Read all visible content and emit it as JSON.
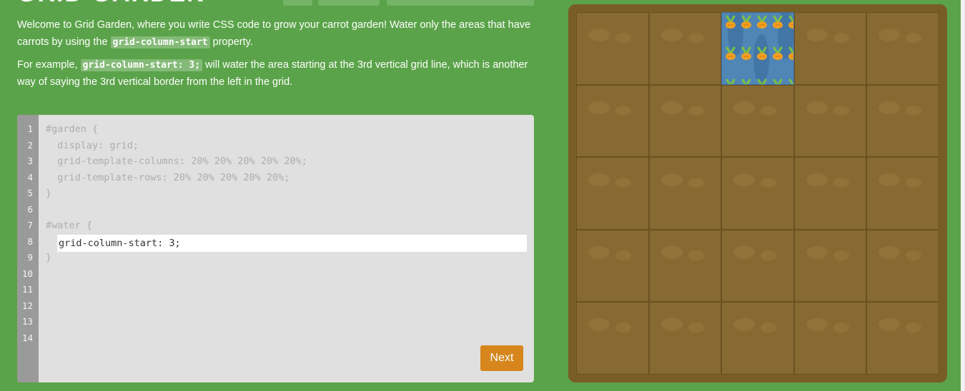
{
  "header": {
    "title": "GRID GARDEN"
  },
  "instructions": {
    "p1_a": "Welcome to Grid Garden, where you write CSS code to grow your carrot garden! Water only the areas that have carrots by using the ",
    "p1_code": "grid-column-start",
    "p1_b": " property.",
    "p2_a": "For example, ",
    "p2_code": "grid-column-start: 3;",
    "p2_b": " will water the area starting at the 3rd vertical grid line, which is another way of saying the 3rd vertical border from the left in the grid."
  },
  "editor": {
    "lines": [
      {
        "num": "1",
        "text": "#garden {"
      },
      {
        "num": "2",
        "text": "  display: grid;"
      },
      {
        "num": "3",
        "text": "  grid-template-columns: 20% 20% 20% 20% 20%;"
      },
      {
        "num": "4",
        "text": "  grid-template-rows: 20% 20% 20% 20% 20%;"
      },
      {
        "num": "5",
        "text": "}"
      },
      {
        "num": "6",
        "text": ""
      },
      {
        "num": "7",
        "text": "#water {"
      },
      {
        "num": "8",
        "text": ""
      },
      {
        "num": "9",
        "text": "}"
      },
      {
        "num": "10",
        "text": ""
      },
      {
        "num": "11",
        "text": ""
      },
      {
        "num": "12",
        "text": ""
      },
      {
        "num": "13",
        "text": ""
      },
      {
        "num": "14",
        "text": ""
      }
    ],
    "input_value": "grid-column-start: 3;",
    "next_label": "Next"
  },
  "garden": {
    "columns": 5,
    "rows": 5,
    "water_column_start": 3,
    "colors": {
      "soil": "#866a32",
      "board": "#785d25",
      "water": "#5086b6",
      "carrot": "#f0a020",
      "leaf": "#7cc242"
    }
  }
}
